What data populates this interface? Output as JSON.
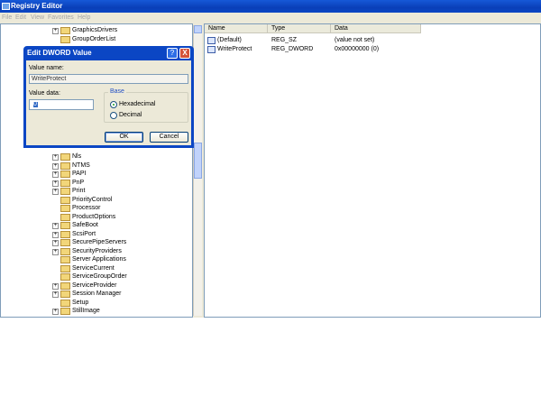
{
  "window": {
    "title": "Registry Editor"
  },
  "menu": [
    "File",
    "Edit",
    "View",
    "Favorites",
    "Help"
  ],
  "tree": {
    "top_items": [
      {
        "label": "GraphicsDrivers",
        "expandable": true
      },
      {
        "label": "GroupOrderList",
        "expandable": false
      }
    ],
    "items": [
      {
        "label": "Nls",
        "expandable": true
      },
      {
        "label": "NTMS",
        "expandable": true
      },
      {
        "label": "PAPI",
        "expandable": true
      },
      {
        "label": "PnP",
        "expandable": true
      },
      {
        "label": "Print",
        "expandable": true
      },
      {
        "label": "PriorityControl",
        "expandable": false
      },
      {
        "label": "Processor",
        "expandable": false
      },
      {
        "label": "ProductOptions",
        "expandable": false
      },
      {
        "label": "SafeBoot",
        "expandable": true
      },
      {
        "label": "ScsiPort",
        "expandable": true
      },
      {
        "label": "SecurePipeServers",
        "expandable": true
      },
      {
        "label": "SecurityProviders",
        "expandable": true
      },
      {
        "label": "Server Applications",
        "expandable": false
      },
      {
        "label": "ServiceCurrent",
        "expandable": false
      },
      {
        "label": "ServiceGroupOrder",
        "expandable": false
      },
      {
        "label": "ServiceProvider",
        "expandable": true
      },
      {
        "label": "Session Manager",
        "expandable": true
      },
      {
        "label": "Setup",
        "expandable": false
      },
      {
        "label": "StillImage",
        "expandable": true
      }
    ]
  },
  "list": {
    "columns": [
      "Name",
      "Type",
      "Data"
    ],
    "rows": [
      {
        "name": "(Default)",
        "type": "REG_SZ",
        "data": "(value not set)"
      },
      {
        "name": "WriteProtect",
        "type": "REG_DWORD",
        "data": "0x00000000 (0)"
      }
    ]
  },
  "dialog": {
    "title": "Edit DWORD Value",
    "help_glyph": "?",
    "close_glyph": "X",
    "value_name_label": "Value name:",
    "value_name": "WriteProtect",
    "value_data_label": "Value data:",
    "value_data": "0",
    "base_label": "Base",
    "hex_label": "Hexadecimal",
    "dec_label": "Decimal",
    "base_selected": "Hexadecimal",
    "ok_label": "OK",
    "cancel_label": "Cancel"
  }
}
